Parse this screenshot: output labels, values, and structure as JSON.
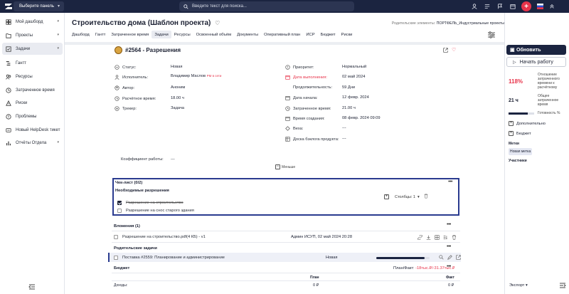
{
  "topbar": {
    "panel_select": "Выберите панель",
    "search_placeholder": "Введите текст для поиска..."
  },
  "sidebar": {
    "items": [
      {
        "label": "Мой дашборд",
        "icon": "dashboard-icon",
        "chevron": true
      },
      {
        "label": "Проекты",
        "icon": "folder-icon",
        "chevron": true
      },
      {
        "label": "Задачи",
        "icon": "tasks-icon",
        "chevron": true,
        "active": true
      },
      {
        "label": "Гантт",
        "icon": "gantt-icon"
      },
      {
        "label": "Ресурсы",
        "icon": "resources-icon"
      },
      {
        "label": "Затраченное время",
        "icon": "clock-icon"
      },
      {
        "label": "Риски",
        "icon": "risk-icon"
      },
      {
        "label": "Проблемы",
        "icon": "problems-icon"
      },
      {
        "label": "Новый HelpDesk тикет",
        "icon": "helpdesk-icon"
      },
      {
        "label": "Отчёты Отдела",
        "icon": "reports-icon",
        "chevron": true
      }
    ]
  },
  "project": {
    "title": "Строительство дома (Шаблон проекта)",
    "related_label": "Родительские элементы:",
    "related_value": "ПОРТФЕЛЬ_Индустриальные проекты"
  },
  "tabs": [
    "Дашборд",
    "Гантт",
    "Затраченное время",
    "Задачи",
    "Ресурсы",
    "Освоенный объём",
    "Документы",
    "Оперативный план",
    "ИСР",
    "Бюджет",
    "Риски"
  ],
  "active_tab": "Задачи",
  "task": {
    "title": "#2564 - Разрешения",
    "fields_left": [
      {
        "label": "Статус:",
        "value": "Новая",
        "icon": "status-icon"
      },
      {
        "label": "Исполнитель:",
        "value": "Владимир Маслов",
        "badge": "PM в сети",
        "icon": "user-icon"
      },
      {
        "label": "Автор:",
        "value": "Аноним",
        "icon": "author-icon"
      },
      {
        "label": "Расчётное время:",
        "value": "18.00 ч",
        "icon": "clock-icon"
      },
      {
        "label": "Трекер:",
        "value": "Задача",
        "icon": "tracker-icon"
      }
    ],
    "fields_right": [
      {
        "label": "Приоритет:",
        "value": "Нормальный",
        "icon": "priority-icon"
      },
      {
        "label": "Дата выполнения:",
        "value": "02 май 2024",
        "icon": "calendar-icon",
        "red": true
      },
      {
        "label": "Продолжительность:",
        "value": "59 Дни"
      },
      {
        "label": "Дата начала:",
        "value": "12 февр. 2024",
        "icon": "calendar-icon"
      },
      {
        "label": "Затраченное время:",
        "value": "21.00 ч",
        "icon": "clock-icon"
      },
      {
        "label": "Время создания:",
        "value": "08 февр. 2024 09:09",
        "icon": "calendar-icon"
      },
      {
        "label": "Веха:",
        "value": "---",
        "icon": "milestone-icon"
      },
      {
        "label": "Доска бэклога продукта:",
        "value": "---",
        "icon": "board-icon"
      }
    ],
    "coef_label": "Коэффициент работы:",
    "coef_value": "---",
    "less_label": "Меньше"
  },
  "checklist": {
    "title": "Чек-лист (0/2)",
    "subtitle": "Необходимые разрешения",
    "columns_label": "Столбцы: 1",
    "items": [
      {
        "label": "Разрешение на строительство",
        "checked": true
      },
      {
        "label": "Разрешение на снос старого здания",
        "checked": false
      }
    ]
  },
  "attachments": {
    "title": "Вложения (1)",
    "file": "Разрешение на строительство.pdf(4 КБ) - v1",
    "meta": "Админ ИСУП, 02 май 2024 20:28"
  },
  "parent": {
    "title": "Родительские задачи",
    "task": "Поставка #2559: Планирование и администрирование",
    "status": "Новая",
    "progress": 0.9
  },
  "budget": {
    "title": "Бюджет",
    "plan_fact_label": "План/Факт:",
    "plan_fact_value": "-18тыс.₽/-31.37тыс.₽",
    "col_plan": "План",
    "col_fact": "Факт",
    "row_label": "Доходы:",
    "row_plan": "0 ₽",
    "row_fact": "0 ₽"
  },
  "right_panel": {
    "update": "Обновить",
    "start": "Начать работу",
    "percent": "118%",
    "percent_label": "Отношение затраченного времени к расчётному",
    "hours": "21 ч",
    "hours_label": "Общее затраченное время",
    "ready_label": "Готовность %",
    "ready_value": 0.75,
    "extra": "Дополнительно",
    "budget": "Бюджет",
    "tags_label": "Метки",
    "tag": "Новая метка",
    "members_label": "Участники",
    "export": "Экспорт"
  }
}
